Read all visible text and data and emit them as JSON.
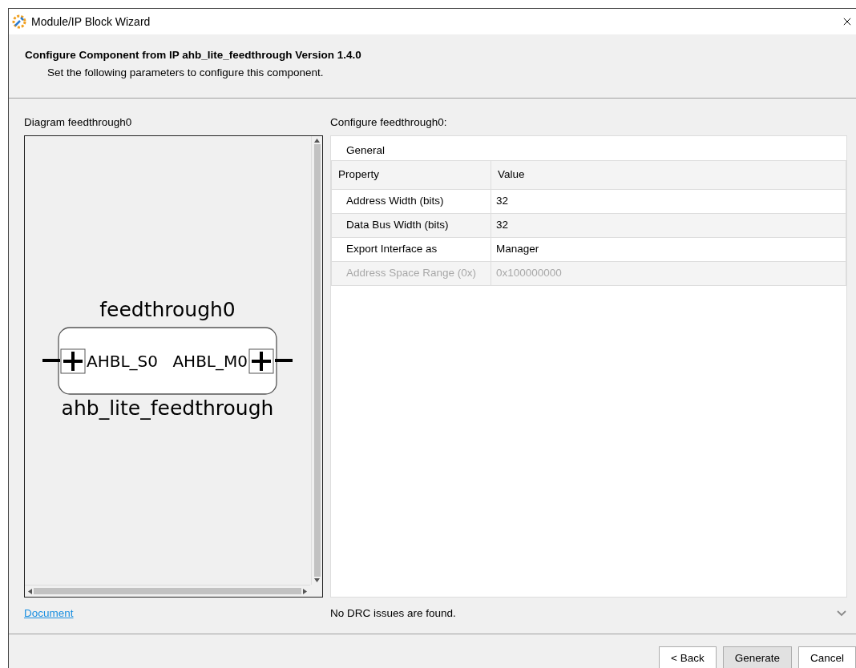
{
  "window": {
    "title": "Module/IP Block Wizard"
  },
  "header": {
    "title": "Configure Component from IP ahb_lite_feedthrough Version 1.4.0",
    "subtitle": "Set the following parameters to configure this component."
  },
  "diagram": {
    "label": "Diagram feedthrough0",
    "instance": "feedthrough0",
    "component": "ahb_lite_feedthrough",
    "ports": [
      "AHBL_S0",
      "AHBL_M0"
    ]
  },
  "config": {
    "label": "Configure feedthrough0:",
    "group": "General",
    "columns": [
      "Property",
      "Value"
    ],
    "rows": [
      {
        "property": "Address Width (bits)",
        "value": "32",
        "disabled": false
      },
      {
        "property": "Data Bus Width (bits)",
        "value": "32",
        "disabled": false
      },
      {
        "property": "Export Interface as",
        "value": "Manager",
        "disabled": false
      },
      {
        "property": "Address Space Range (0x)",
        "value": "0x100000000",
        "disabled": true
      }
    ]
  },
  "document_link": "Document",
  "status": "No DRC issues are found.",
  "buttons": [
    {
      "label": "< Back",
      "default": false
    },
    {
      "label": "Generate",
      "default": true
    },
    {
      "label": "Cancel",
      "default": false
    }
  ]
}
